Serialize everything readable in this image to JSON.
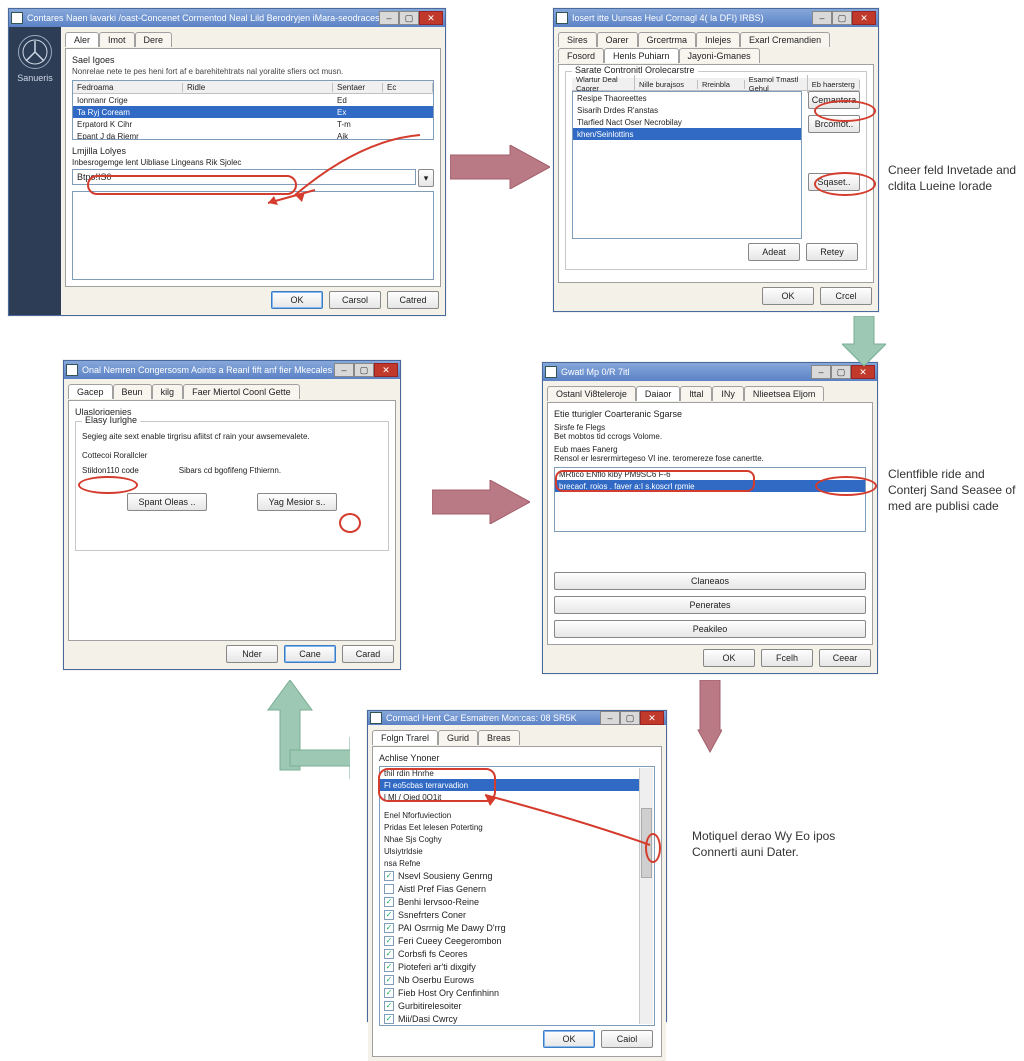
{
  "annotations": {
    "note1": "Cneer feld Invetade and cldita Lueine lorade",
    "note2": "Clentfible ride and Conterj Sand Seasee of med are publisi cade",
    "note3": "Motiquel derao Wy Eo ipos Connerti auni Dater."
  },
  "w1": {
    "title": "Contares Naen lavarki /oast-Concenet Cormentod Neal Lild Berodryjen iMara-seodracese Srgt.",
    "tabs": [
      "Aler",
      "Imot",
      "Dere"
    ],
    "section1": "Sael Igoes",
    "section1_sub": "Nonrelae nete te pes heni fort af e barehitehtrats nal yoralite sfiers oct musn.",
    "cols": {
      "c1": "Fedroama",
      "c2": "Ridle",
      "c3": "Sentaer",
      "c4": "Ec"
    },
    "rows": {
      "r1": {
        "a": "Ionmanr Crige",
        "b": "",
        "c": "Ed",
        "d": ""
      },
      "r2": {
        "a": "Ta Ryj Coream",
        "b": "",
        "c": "Ex",
        "d": ""
      },
      "r3": {
        "a": "Erpatord K Cihr",
        "b": "",
        "c": "T-m",
        "d": ""
      },
      "r4": {
        "a": "Epant J da Riemr",
        "b": "",
        "c": "Aik",
        "d": ""
      }
    },
    "section2": "Lmjilla Lolyes",
    "section2_sub": "Inbesrogemge lent Uibliase Lingeans Rik Sjolec",
    "input_val": "Btpo!IS0",
    "buttons": {
      "ok": "OK",
      "cancel": "Carsol",
      "apply": "Catred"
    },
    "brand": "Sanueris"
  },
  "w2": {
    "title": "Iosert itte Uunsas Heul Cornagl 4( la DFI) IRBS)",
    "tabs_top": [
      "Sires",
      "Oarer",
      "Grcertrma",
      "Inlejes",
      "Exarl Cremandien"
    ],
    "tabs_bot": [
      "Fosord",
      "Henls Puhiarn",
      "Jayoni-Gmanes"
    ],
    "group": "Sarate Contronitl Orolecarstre",
    "head": [
      "Wlartur Deal Caorer",
      "Nille burajsos",
      "Rreinbla",
      "Esamol Tmastl Gehul",
      "Eb haersterg"
    ],
    "rows": {
      "r1": "Resipe Thaoreettes",
      "r2": "Sisarih Drdes R'anstas",
      "r3": "Tlarfied Nact Oser Necrobilay",
      "r4": "khen/Seinlottins"
    },
    "sidebtns": {
      "b1": "Cemantera",
      "b2": "Brcomot..",
      "b3": "Sqaset.."
    },
    "buttons": {
      "b1": "Adeat",
      "b2": "Retey",
      "ok": "OK",
      "cancel": "Crcel"
    }
  },
  "w3": {
    "title": "Onal Nemren Congersosm Aoints a Reanl fift anf fier Mkecales",
    "tabs": [
      "Gacep",
      "Beun",
      "kilg",
      "Faer Miertol Coonl Gette"
    ],
    "section": "Ulaslorigenies",
    "group": "Elasy Iurlghe",
    "group_sub": "Segieg aite sext enable tirgrisu afiitst cf rain your awsemevalete.",
    "subgroup": "Cottecoi Rorallcler",
    "field": "Stildon110 code",
    "field2": "Sibars cd bgofifeng Fthiernn.",
    "btns": {
      "b1": "Spant Oleas ..",
      "b2": "Yag Mesior s.."
    },
    "buttons": {
      "b1": "Nder",
      "b2": "Cane",
      "b3": "Carad"
    }
  },
  "w4": {
    "title": "Gwatl Mp                       0/R 7itl",
    "tabs": [
      "Ostanl Vi8teleroje",
      "Daiaor",
      "lttal",
      "INy",
      "Nlieetsea Eljom"
    ],
    "section": "Etie tturigler Coarteranic Sgarse",
    "l1": "Sirsfe fe Flegs",
    "l1b": "Bet mobtos tid ccrogs Volome.",
    "l2": "Eub maes Fanerg",
    "l2b": "Rensol er lesrermirtegeso VI ine. teromereze fose canertte.",
    "row1": "MRtico ENflo kiby PM9SC6 F-6",
    "row2": "brecaof. roios . faver a:I s.koscrl rpmie",
    "sidebtns": {
      "b1": "Claneaos",
      "b2": "Penerates",
      "b3": "Peakileo"
    },
    "buttons": {
      "ok": "OK",
      "b2": "Fcelh",
      "b3": "Ceear"
    }
  },
  "w5": {
    "title": "Cormacl Hent Car Esmatren Mon:cas: 08 SR5K",
    "tabs": [
      "Folgn Trarel",
      "Gurid",
      "Breas"
    ],
    "section": "Achlise Ynoner",
    "items": {
      "i1": "thil rdin Hnrhe",
      "i2": "Fl eo5cbas terrarvadion",
      "i3": "l Ml / Oied  0O1it",
      "i4": "Enel Nforfuviection",
      "i5": "Pridas Eet lelesen Poterting",
      "i6": "Nhae Sjs Coghy",
      "i7": "Ulsiytrldsie",
      "i8": "nsa Refne",
      "c1": "Nsevl Sousieny Genrng",
      "c2": "Aistl Pref Fias Genern",
      "c3": "Benhi lervsoo-Reine",
      "c4": "Ssnefrters Coner",
      "c5": "PAI Osrrnig Me Dawy D'rrg",
      "c6": "Feri Cueey Ceegerombon",
      "c7": "Corbsfi fs Ceores",
      "c8": "Pioteferi ar'ti dixgify",
      "c9": "Nb Oserbu Eurows",
      "c10": "Fieb Host Ory Cenfinhinn",
      "c11": "Gurbitirelesoiter",
      "c12": "Mii/Dasi Cwrcy"
    },
    "buttons": {
      "ok": "OK",
      "cancel": "Caiol"
    }
  }
}
